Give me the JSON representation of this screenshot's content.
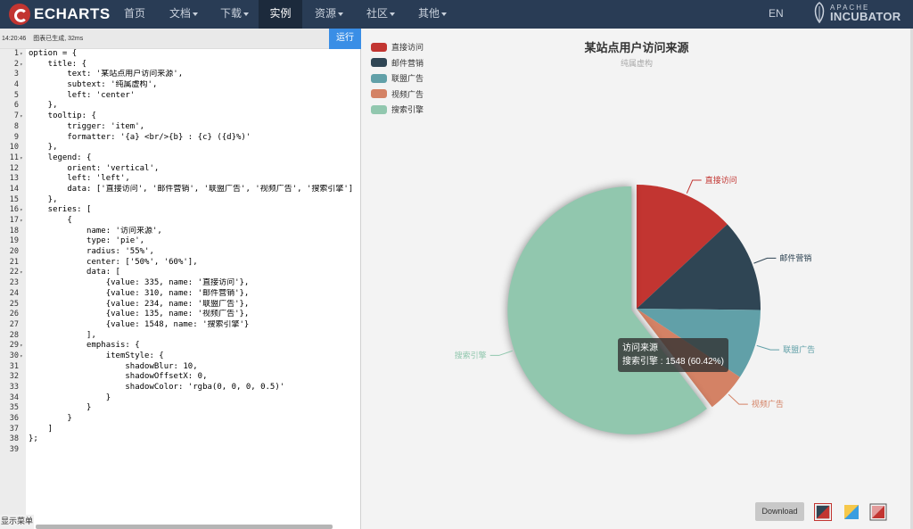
{
  "nav": {
    "brand": "ECHARTS",
    "items": [
      {
        "label": "首页",
        "has_caret": false
      },
      {
        "label": "文档",
        "has_caret": true
      },
      {
        "label": "下载",
        "has_caret": true
      },
      {
        "label": "实例",
        "has_caret": false,
        "active": true
      },
      {
        "label": "资源",
        "has_caret": true
      },
      {
        "label": "社区",
        "has_caret": true
      },
      {
        "label": "其他",
        "has_caret": true
      }
    ],
    "lang": "EN",
    "incubator_top": "APACHE",
    "incubator_bottom": "INCUBATOR"
  },
  "editor": {
    "status_time": "14:20:46",
    "status_text": "图表已生成, 32ms",
    "run_label": "运行",
    "show_menu": "显示菜单",
    "lines": [
      "option = {",
      "    title: {",
      "        text: '某站点用户访问来源',",
      "        subtext: '纯属虚构',",
      "        left: 'center'",
      "    },",
      "    tooltip: {",
      "        trigger: 'item',",
      "        formatter: '{a} <br/>{b} : {c} ({d}%)'",
      "    },",
      "    legend: {",
      "        orient: 'vertical',",
      "        left: 'left',",
      "        data: ['直接访问', '邮件营销', '联盟广告', '视频广告', '搜索引擎']",
      "    },",
      "    series: [",
      "        {",
      "            name: '访问来源',",
      "            type: 'pie',",
      "            radius: '55%',",
      "            center: ['50%', '60%'],",
      "            data: [",
      "                {value: 335, name: '直接访问'},",
      "                {value: 310, name: '邮件营销'},",
      "                {value: 234, name: '联盟广告'},",
      "                {value: 135, name: '视频广告'},",
      "                {value: 1548, name: '搜索引擎'}",
      "            ],",
      "            emphasis: {",
      "                itemStyle: {",
      "                    shadowBlur: 10,",
      "                    shadowOffsetX: 0,",
      "                    shadowColor: 'rgba(0, 0, 0, 0.5)'",
      "                }",
      "            }",
      "        }",
      "    ]",
      "};",
      ""
    ],
    "fold_lines": [
      1,
      2,
      7,
      11,
      16,
      17,
      22,
      29,
      30
    ]
  },
  "chart": {
    "title": "某站点用户访问来源",
    "subtitle": "纯属虚构",
    "tooltip_series": "访问来源",
    "tooltip_text": "搜索引擎 : 1548 (60.42%)",
    "download_label": "Download",
    "theme_icons": [
      "theme-red-icon",
      "theme-yellow-icon",
      "theme-red-gradient-icon"
    ]
  },
  "chart_data": {
    "type": "pie",
    "title": "某站点用户访问来源",
    "subtitle": "纯属虚构",
    "legend_position": "top-left",
    "categories": [
      "直接访问",
      "邮件营销",
      "联盟广告",
      "视频广告",
      "搜索引擎"
    ],
    "values": [
      335,
      310,
      234,
      135,
      1548
    ],
    "colors": [
      "#c23531",
      "#2f4554",
      "#61a0a8",
      "#d48265",
      "#91c7ae"
    ],
    "highlighted": "搜索引擎"
  }
}
